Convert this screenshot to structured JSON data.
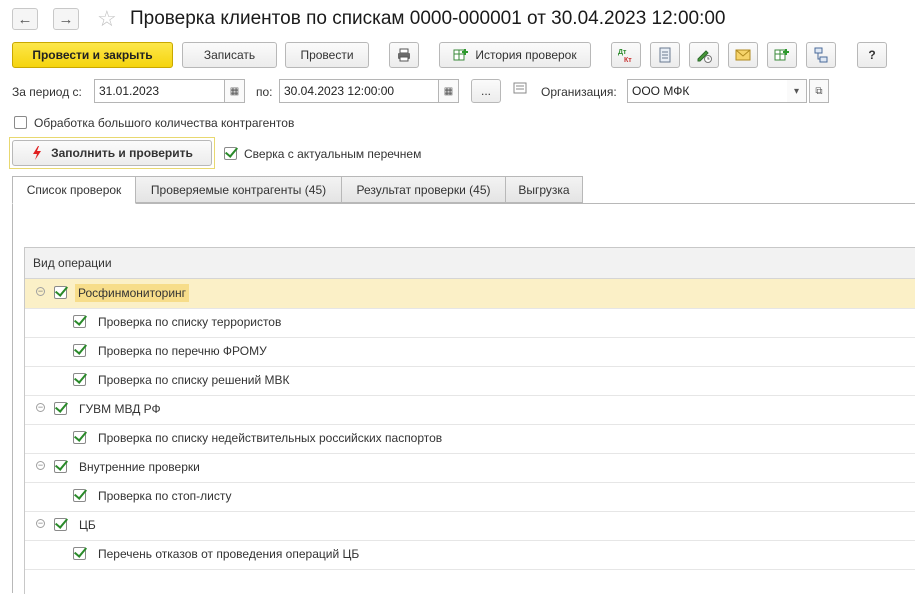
{
  "window": {
    "title": "Проверка клиентов по спискам 0000-000001 от 30.04.2023 12:00:00"
  },
  "toolbar": {
    "post_close_label": "Провести и закрыть",
    "save_label": "Записать",
    "post_label": "Провести",
    "history_label": "История проверок",
    "help_label": "?"
  },
  "filters": {
    "period_from_label": "За период с:",
    "period_from_value": "31.01.2023",
    "period_to_label": "по:",
    "period_to_value": "30.04.2023 12:00:00",
    "ellipsis": "...",
    "org_label": "Организация:",
    "org_value": "ООО МФК",
    "bulk_label": "Обработка большого количества контрагентов",
    "bulk_checked": false,
    "fill_check_label": "Заполнить и проверить",
    "sverka_label": "Сверка с актуальным перечнем",
    "sverka_checked": true
  },
  "tabs": [
    {
      "label": "Список проверок",
      "active": true
    },
    {
      "label": "Проверяемые контрагенты (45)",
      "active": false
    },
    {
      "label": "Результат проверки (45)",
      "active": false
    },
    {
      "label": "Выгрузка",
      "active": false
    }
  ],
  "grid": {
    "column_header": "Вид операции",
    "rows": [
      {
        "label": "Росфинмониторинг",
        "level": 0,
        "checked": true,
        "selected": true
      },
      {
        "label": "Проверка по списку террористов",
        "level": 1,
        "checked": true
      },
      {
        "label": "Проверка по перечню ФРОМУ",
        "level": 1,
        "checked": true
      },
      {
        "label": "Проверка по списку решений МВК",
        "level": 1,
        "checked": true
      },
      {
        "label": "ГУВМ МВД РФ",
        "level": 0,
        "checked": true
      },
      {
        "label": "Проверка по списку недействительных российских паспортов",
        "level": 1,
        "checked": true
      },
      {
        "label": "Внутренние проверки",
        "level": 0,
        "checked": true
      },
      {
        "label": "Проверка по стоп-листу",
        "level": 1,
        "checked": true
      },
      {
        "label": "ЦБ",
        "level": 0,
        "checked": true
      },
      {
        "label": "Перечень отказов от проведения операций ЦБ",
        "level": 1,
        "checked": true
      }
    ]
  }
}
